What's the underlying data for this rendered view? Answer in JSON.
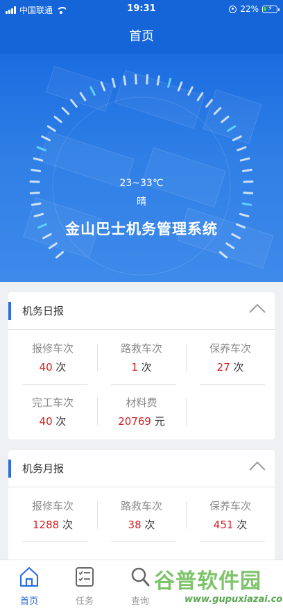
{
  "status_bar": {
    "carrier": "中国联通",
    "time": "19:31",
    "battery": "22%",
    "battery_level": 0.22
  },
  "nav": {
    "title": "首页"
  },
  "hero": {
    "temperature": "23~33℃",
    "weather": "晴",
    "system_name": "金山巴士机务管理系统"
  },
  "daily_report": {
    "title": "机务日报",
    "items": [
      {
        "label": "报修车次",
        "value": "40",
        "unit": "次"
      },
      {
        "label": "路救车次",
        "value": "1",
        "unit": "次"
      },
      {
        "label": "保养车次",
        "value": "27",
        "unit": "次"
      },
      {
        "label": "完工车次",
        "value": "40",
        "unit": "次"
      },
      {
        "label": "材料费",
        "value": "20769",
        "unit": "元"
      }
    ]
  },
  "monthly_report": {
    "title": "机务月报",
    "items": [
      {
        "label": "报修车次",
        "value": "1288",
        "unit": "次"
      },
      {
        "label": "路救车次",
        "value": "38",
        "unit": "次"
      },
      {
        "label": "保养车次",
        "value": "451",
        "unit": "次"
      }
    ]
  },
  "tabs": [
    {
      "label": "首页",
      "icon": "home-icon",
      "active": true
    },
    {
      "label": "任务",
      "icon": "task-list-icon",
      "active": false
    },
    {
      "label": "查询",
      "icon": "search-icon",
      "active": false
    }
  ],
  "watermark": {
    "brand": "谷普软件园",
    "url": "www.gupuxiazai.com"
  },
  "colors": {
    "primary": "#1565d8",
    "accent_value": "#d71d1d",
    "watermark": "#7cc36a"
  }
}
